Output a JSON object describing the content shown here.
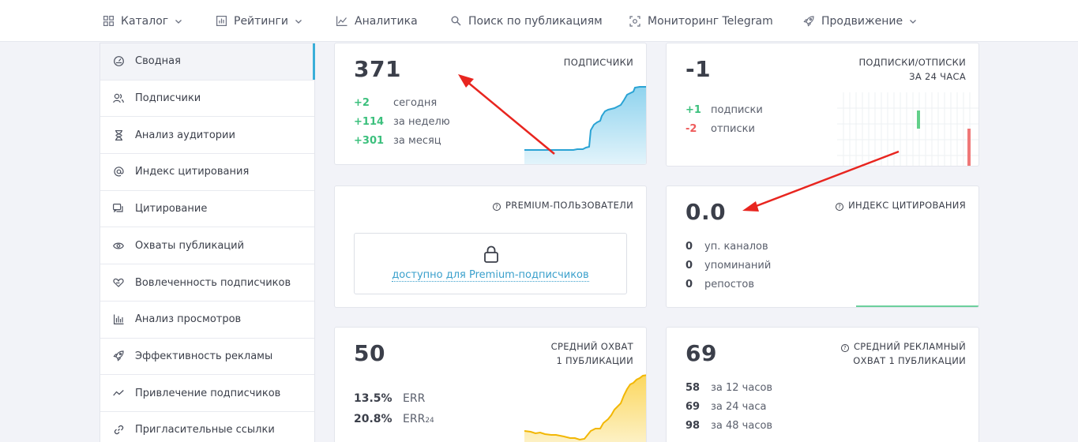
{
  "nav": [
    {
      "label": "Каталог",
      "icon": "grid-icon",
      "dropdown": true
    },
    {
      "label": "Рейтинги",
      "icon": "bar-chart-icon",
      "dropdown": true
    },
    {
      "label": "Аналитика",
      "icon": "line-chart-icon",
      "dropdown": false
    },
    {
      "label": "Поиск по публикациям",
      "icon": "search-icon",
      "dropdown": false
    },
    {
      "label": "Мониторинг Telegram",
      "icon": "monitor-icon",
      "dropdown": false
    },
    {
      "label": "Продвижение",
      "icon": "rocket-icon",
      "dropdown": true
    }
  ],
  "sidebar": {
    "items": [
      {
        "label": "Сводная",
        "icon": "dashboard-icon",
        "active": true
      },
      {
        "label": "Подписчики",
        "icon": "users-icon"
      },
      {
        "label": "Анализ аудитории",
        "icon": "hourglass-icon"
      },
      {
        "label": "Индекс цитирования",
        "icon": "at-icon"
      },
      {
        "label": "Цитирование",
        "icon": "quote-icon"
      },
      {
        "label": "Охваты публикаций",
        "icon": "eye-icon"
      },
      {
        "label": "Вовлеченность подписчиков",
        "icon": "heart-hand-icon"
      },
      {
        "label": "Анализ просмотров",
        "icon": "bar-chart-icon"
      },
      {
        "label": "Эффективность рекламы",
        "icon": "rocket-icon"
      },
      {
        "label": "Привлечение подписчиков",
        "icon": "trend-icon"
      },
      {
        "label": "Пригласительные ссылки",
        "icon": "link-icon"
      }
    ]
  },
  "cards": {
    "subscribers": {
      "value": "371",
      "title": "подписчики",
      "stats": [
        {
          "value": "+2",
          "label": "сегодня"
        },
        {
          "value": "+114",
          "label": "за неделю"
        },
        {
          "value": "+301",
          "label": "за месяц"
        }
      ]
    },
    "subs_unsubs": {
      "value": "-1",
      "title_line1": "подписки/отписки",
      "title_line2": "за 24 часа",
      "stats": [
        {
          "value": "+1",
          "label": "подписки"
        },
        {
          "value": "-2",
          "label": "отписки"
        }
      ]
    },
    "premium": {
      "title": "PREMIUM-ПОЛЬЗОВАТЕЛИ",
      "link": "доступно для Premium-подписчиков"
    },
    "citation": {
      "value": "0.0",
      "title": "ИНДЕКС ЦИТИРОВАНИЯ",
      "stats": [
        {
          "value": "0",
          "label": "уп. каналов"
        },
        {
          "value": "0",
          "label": "упоминаний"
        },
        {
          "value": "0",
          "label": "репостов"
        }
      ]
    },
    "reach": {
      "value": "50",
      "title_line1": "СРЕДНИЙ ОХВАТ",
      "title_line2": "1 ПУБЛИКАЦИИ",
      "stats": [
        {
          "value": "13.5%",
          "label": "ERR"
        },
        {
          "value": "20.8%",
          "label": "ERR",
          "sub": "24"
        }
      ]
    },
    "ad_reach": {
      "value": "69",
      "title_line1": "СРЕДНИЙ РЕКЛАМНЫЙ",
      "title_line2": "ОХВАТ 1 ПУБЛИКАЦИИ",
      "stats": [
        {
          "value": "58",
          "label": "за 12 часов"
        },
        {
          "value": "69",
          "label": "за 24 часа"
        },
        {
          "value": "98",
          "label": "за 48 часов"
        }
      ]
    }
  },
  "colors": {
    "accent": "#3aaed8",
    "positive": "#3cc07d",
    "negative": "#ef5b5b",
    "reach_chart": "#f5c12e"
  }
}
